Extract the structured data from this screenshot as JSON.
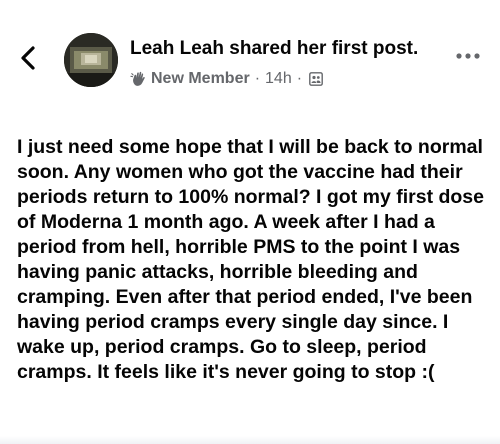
{
  "post": {
    "author_name": "Leah Leah",
    "action_text": "shared her first post.",
    "badge_label": "New Member",
    "separator": "·",
    "timestamp": "14h",
    "body": "I just need some hope that I will be back to normal soon. Any women who got the vaccine had their periods return to 100% normal? I got my first dose of Moderna 1 month ago. A week after I had a period from hell, horrible PMS to the point I was having panic attacks, horrible bleeding and cramping. Even after that period ended, I've been having period cramps every single day since. I wake up, period cramps. Go to sleep, period cramps. It feels like it's never going to stop :("
  },
  "icons": {
    "back": "chevron-left-icon",
    "badge": "waving-hand-icon",
    "privacy": "group-privacy-icon",
    "more": "more-horizontal-icon"
  },
  "colors": {
    "text": "#050505",
    "meta": "#65676b"
  }
}
